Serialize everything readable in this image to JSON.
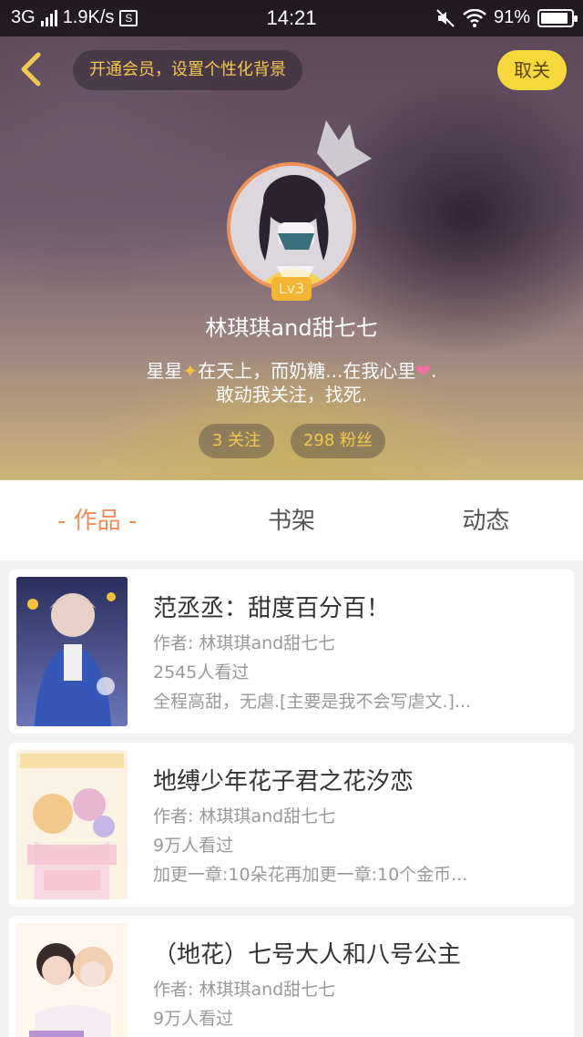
{
  "status_bar": {
    "network": "3G",
    "speed": "1.9K/s",
    "s_icon": "S",
    "time": "14:21",
    "battery": "91%",
    "battery_level": 0.91
  },
  "header": {
    "vip_text": "开通会员，设置个性化背景",
    "unfollow_label": "取关",
    "level": "Lv3",
    "username": "林琪琪and甜七七",
    "bio_line1_a": "星星",
    "bio_line1_b": "在天上，而奶糖...在我心里",
    "bio_line1_c": ".",
    "bio_line2": "敢动我关注，找死.",
    "following": "3 关注",
    "fans": "298 粉丝"
  },
  "tabs": [
    {
      "label": "- 作品 -"
    },
    {
      "label": "书架"
    },
    {
      "label": "动态"
    }
  ],
  "books": [
    {
      "title": "范丞丞：甜度百分百！",
      "author": "作者: 林琪琪and甜七七",
      "views": "2545人看过",
      "desc": "全程高甜，无虐.[主要是我不会写虐文.]..."
    },
    {
      "title": "地缚少年花子君之花汐恋",
      "author": "作者: 林琪琪and甜七七",
      "views": "9万人看过",
      "desc": "加更一章:10朵花再加更一章:10个金币..."
    },
    {
      "title": "（地花）七号大人和八号公主",
      "author": "作者: 林琪琪and甜七七",
      "views": "9万人看过",
      "desc": ""
    }
  ],
  "colors": {
    "accent": "#f08c57",
    "gold": "#f2c94c",
    "unfollow_bg": "#f7d83a"
  }
}
